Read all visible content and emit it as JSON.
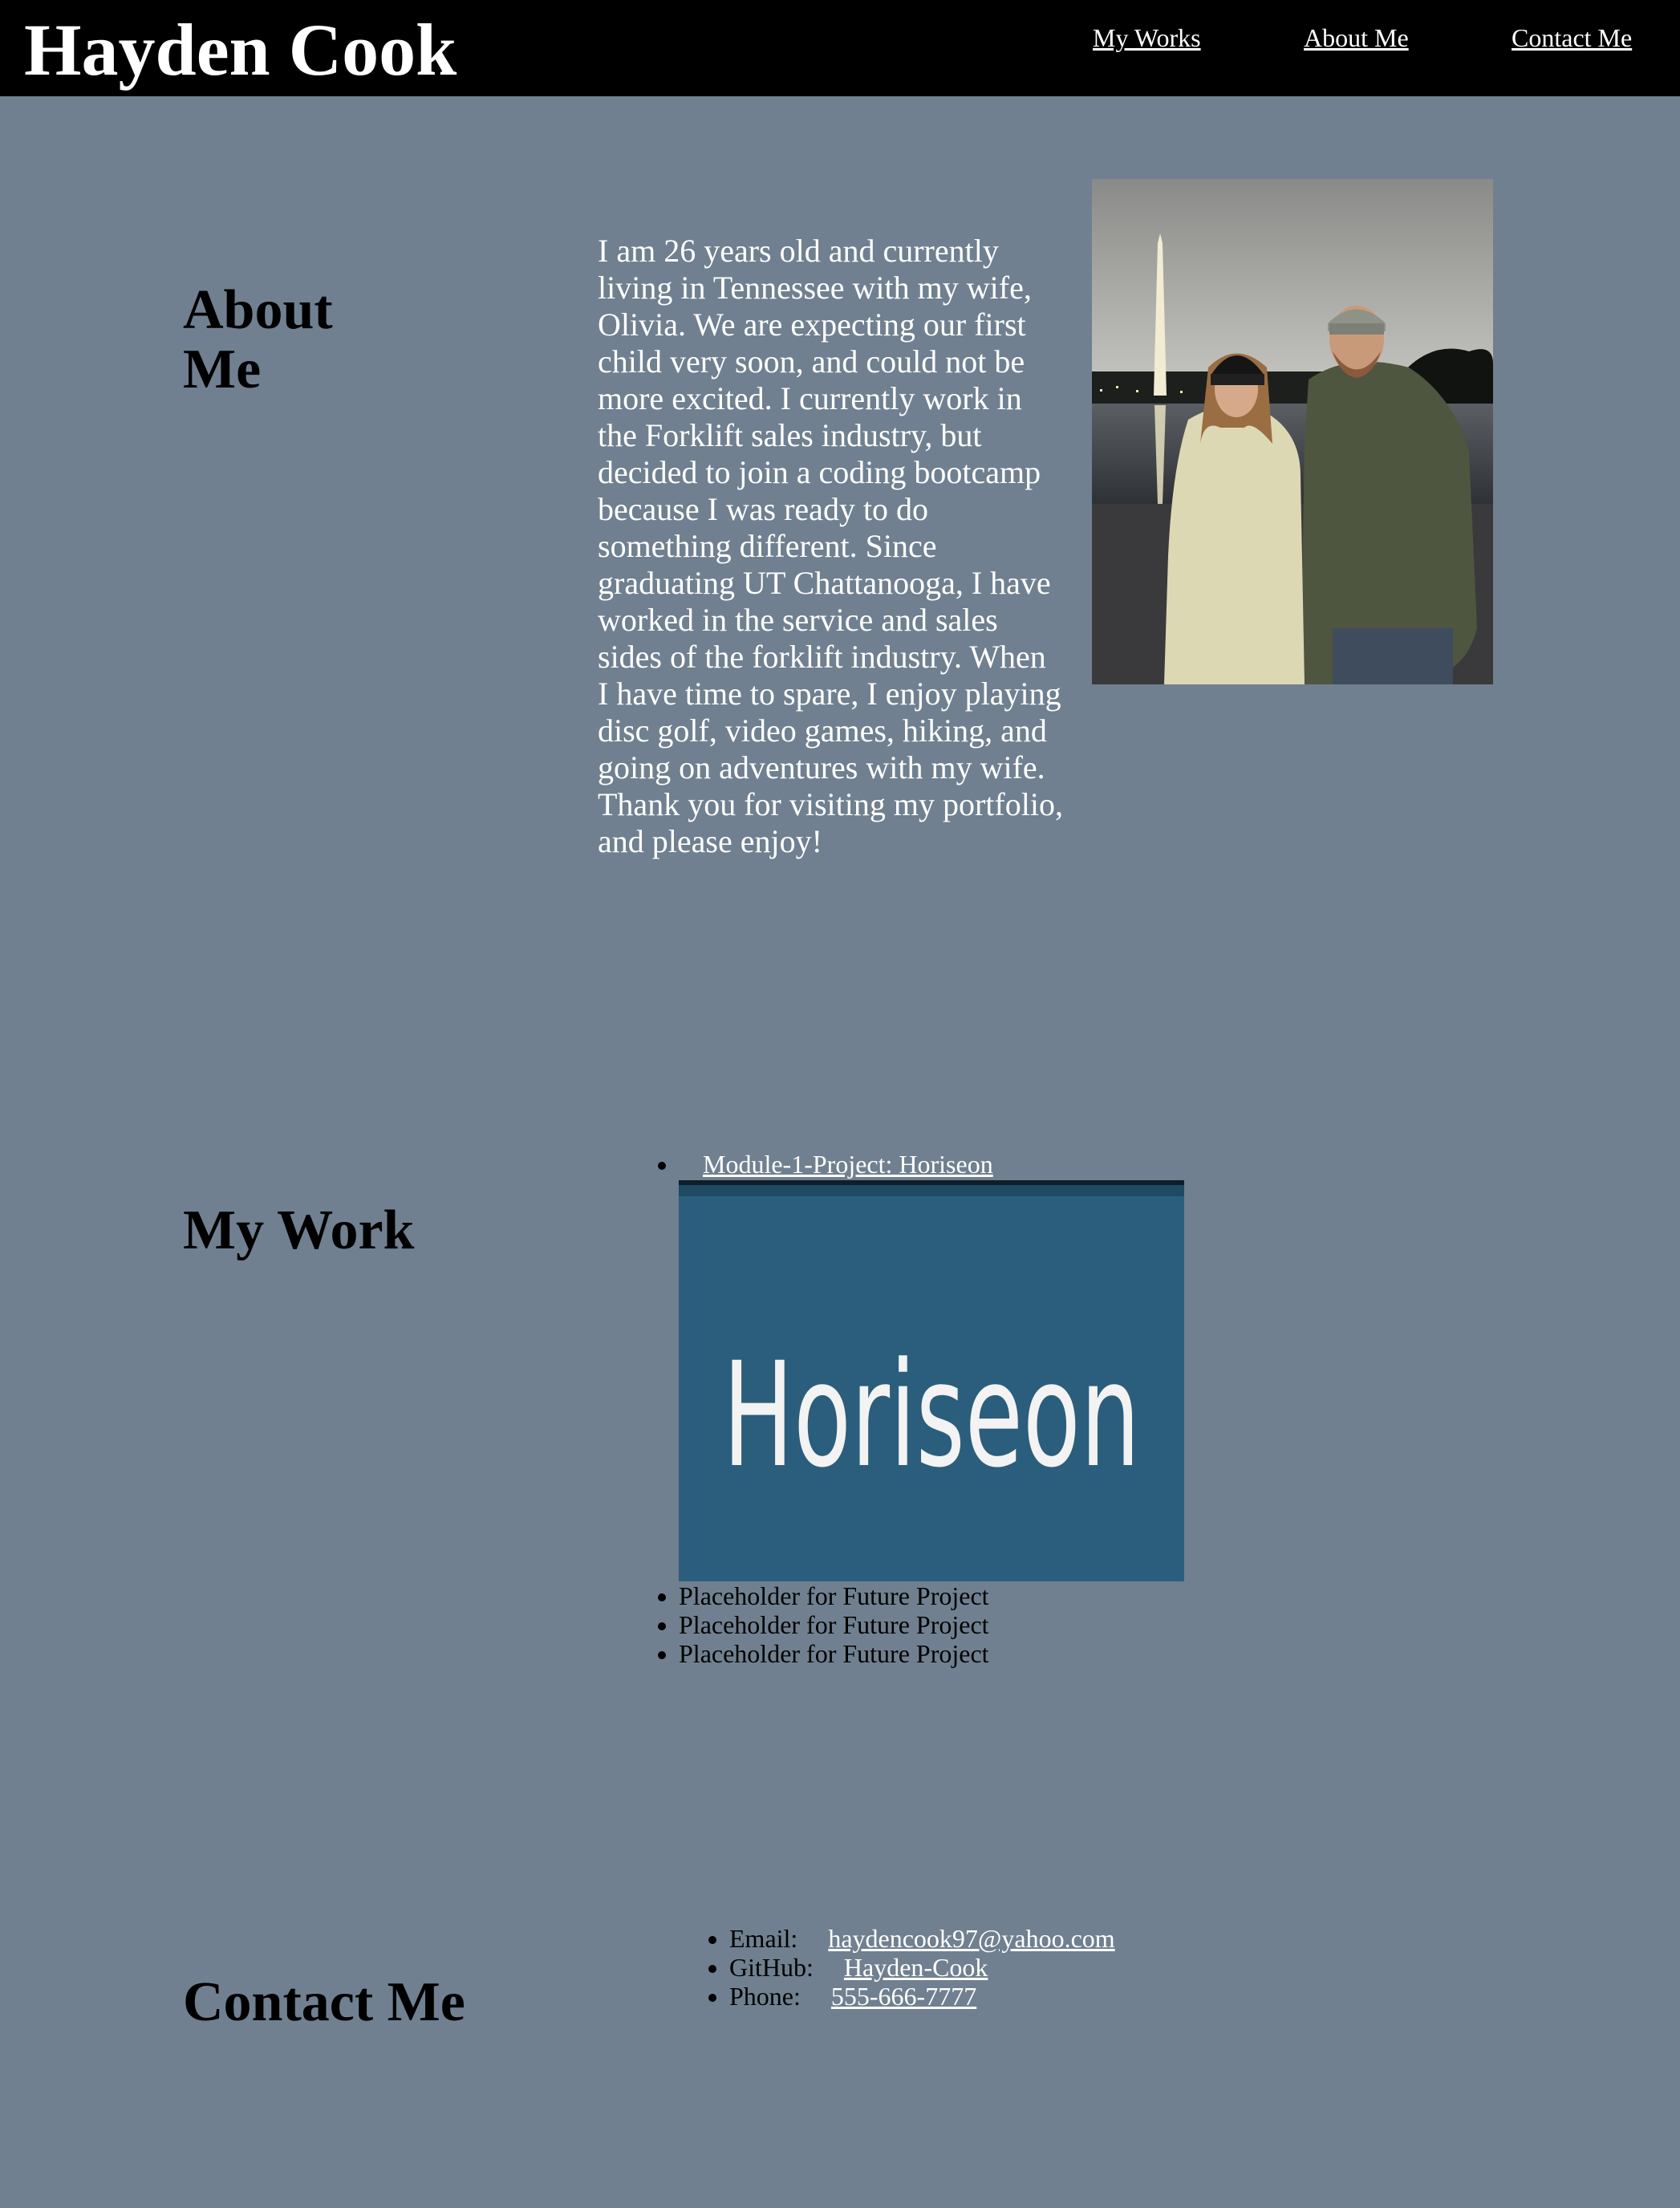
{
  "header": {
    "title": "Hayden Cook",
    "nav": {
      "works": "My Works",
      "about": "About Me",
      "contact": "Contact Me"
    }
  },
  "about": {
    "heading": "About Me",
    "text": "I am 26 years old and currently living in Tennessee with my wife, Olivia. We are expecting our first child very soon, and could not be more excited. I currently work in the Forklift sales industry, but decided to join a coding bootcamp because I was ready to do something different. Since graduating UT Chattanooga, I have worked in the service and sales sides of the forklift industry. When I have time to spare, I enjoy playing disc golf, video games, hiking, and going on adventures with my wife. Thank you for visiting my portfolio, and please enjoy!"
  },
  "work": {
    "heading": "My Work",
    "projects": [
      {
        "label": "Module-1-Project: Horiseon",
        "image_text": "Horiseon"
      },
      {
        "label": "Placeholder for Future Project"
      },
      {
        "label": "Placeholder for Future Project"
      },
      {
        "label": "Placeholder for Future Project"
      }
    ]
  },
  "contact": {
    "heading": "Contact Me",
    "items": [
      {
        "label": "Email:",
        "value": "haydencook97@yahoo.com"
      },
      {
        "label": "GitHub:",
        "value": "Hayden-Cook"
      },
      {
        "label": "Phone:",
        "value": "555-666-7777"
      }
    ]
  },
  "colors": {
    "page_background": "#708090",
    "header_background": "#000000",
    "link": "#ffffff",
    "horiseon_banner": "#2b5e7c"
  }
}
